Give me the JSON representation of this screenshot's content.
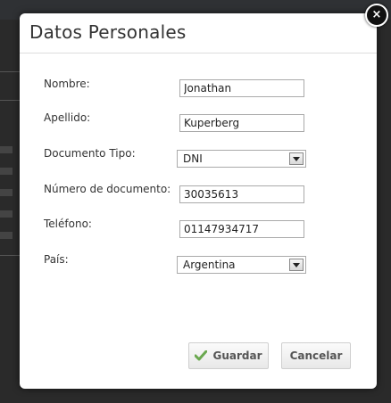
{
  "dialog": {
    "title": "Datos Personales",
    "close_label": "×"
  },
  "form": {
    "nombre": {
      "label": "Nombre:",
      "value": "Jonathan"
    },
    "apellido": {
      "label": "Apellido:",
      "value": "Kuperberg"
    },
    "documento_tipo": {
      "label": "Documento Tipo:",
      "value": "DNI"
    },
    "numero_documento": {
      "label": "Número de documento:",
      "value": "30035613"
    },
    "telefono": {
      "label": "Teléfono:",
      "value": "01147934717"
    },
    "pais": {
      "label": "País:",
      "value": "Argentina"
    }
  },
  "buttons": {
    "guardar": "Guardar",
    "cancelar": "Cancelar"
  },
  "colors": {
    "check_icon": "#6aa84f"
  }
}
